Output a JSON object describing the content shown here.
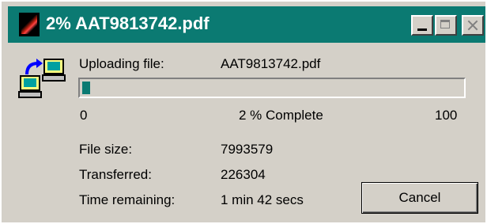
{
  "window": {
    "title": "2% AAT9813742.pdf"
  },
  "upload": {
    "label": "Uploading file:",
    "filename": "AAT9813742.pdf"
  },
  "progress": {
    "value_percent": 2,
    "scale_min": "0",
    "scale_max": "100",
    "percent_text": "2  % Complete"
  },
  "details": {
    "file_size_label": "File size:",
    "file_size_value": "7993579",
    "transferred_label": "Transferred:",
    "transferred_value": "226304",
    "time_remaining_label": "Time remaining:",
    "time_remaining_value": "1 min 42 secs"
  },
  "buttons": {
    "cancel_label": "Cancel"
  },
  "colors": {
    "titlebar": "#0b7a72",
    "progress_fill": "#0b7a72",
    "dialog_face": "#d4d0c8"
  },
  "icons": {
    "app": "app-icon",
    "transfer": "computer-transfer-icon",
    "minimize": "minimize-icon",
    "maximize": "maximize-icon",
    "close": "close-icon"
  }
}
